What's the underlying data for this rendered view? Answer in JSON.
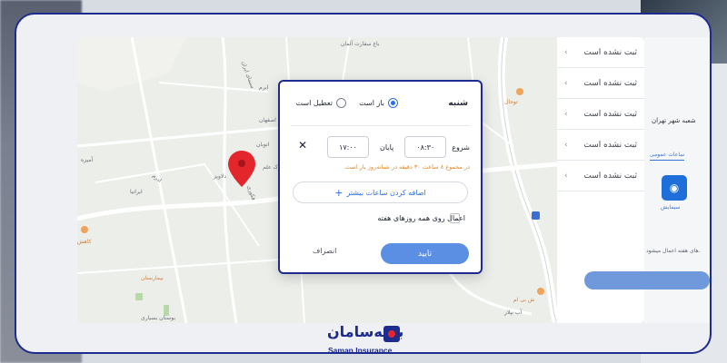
{
  "side_panel": {
    "items": [
      {
        "label": "ثبت نشده است"
      },
      {
        "label": "ثبت نشده است"
      },
      {
        "label": "ثبت نشده است"
      },
      {
        "label": "ثبت نشده است"
      },
      {
        "label": "ثبت نشده است"
      }
    ]
  },
  "right_strip": {
    "title": "شعبه شهر تهران",
    "tab": "ساعات عمومی",
    "tile_label": "سیمایش",
    "note": "های هفته اعمال میشود."
  },
  "map": {
    "labels": [
      "باغ سفارت آلمان",
      "ایرم",
      "سیمای ایران",
      "اصفهان",
      "دلاویز",
      "آمیزه",
      "اتوبان",
      "فکوری",
      "ادرم",
      "ایرانیا",
      "پارک علم"
    ],
    "poi_labels": [
      "توحال",
      "کاهش",
      "بیمارستان",
      "ش بی ام",
      "بوستان بسیاری",
      "آب بپلار"
    ]
  },
  "modal": {
    "day": "شنبه",
    "open_label": "باز است",
    "closed_label": "تعطیل است",
    "start_label": "شروع",
    "start_time": "۰۸:۳۰",
    "end_label": "پایان",
    "end_time": "۱۷:۰۰",
    "warning": "در مجموع ۸ ساعت ۳۰ دقیقه در شبانه‌روز باز است.",
    "add_more": "اضافه کردن ساعات بیشتر",
    "apply_all": "اعمال روی همه روزهای هفته",
    "confirm": "تایید",
    "cancel": "انصراف"
  },
  "logo": {
    "text_fa": "بیمه‌سامان",
    "text_en": "Saman Insurance"
  },
  "colors": {
    "frame": "#1e2b8f",
    "accent": "#2c6fe0",
    "confirm_bg": "#5b8fe3",
    "warning": "#e38b2a",
    "map_pin": "#e2262c"
  }
}
